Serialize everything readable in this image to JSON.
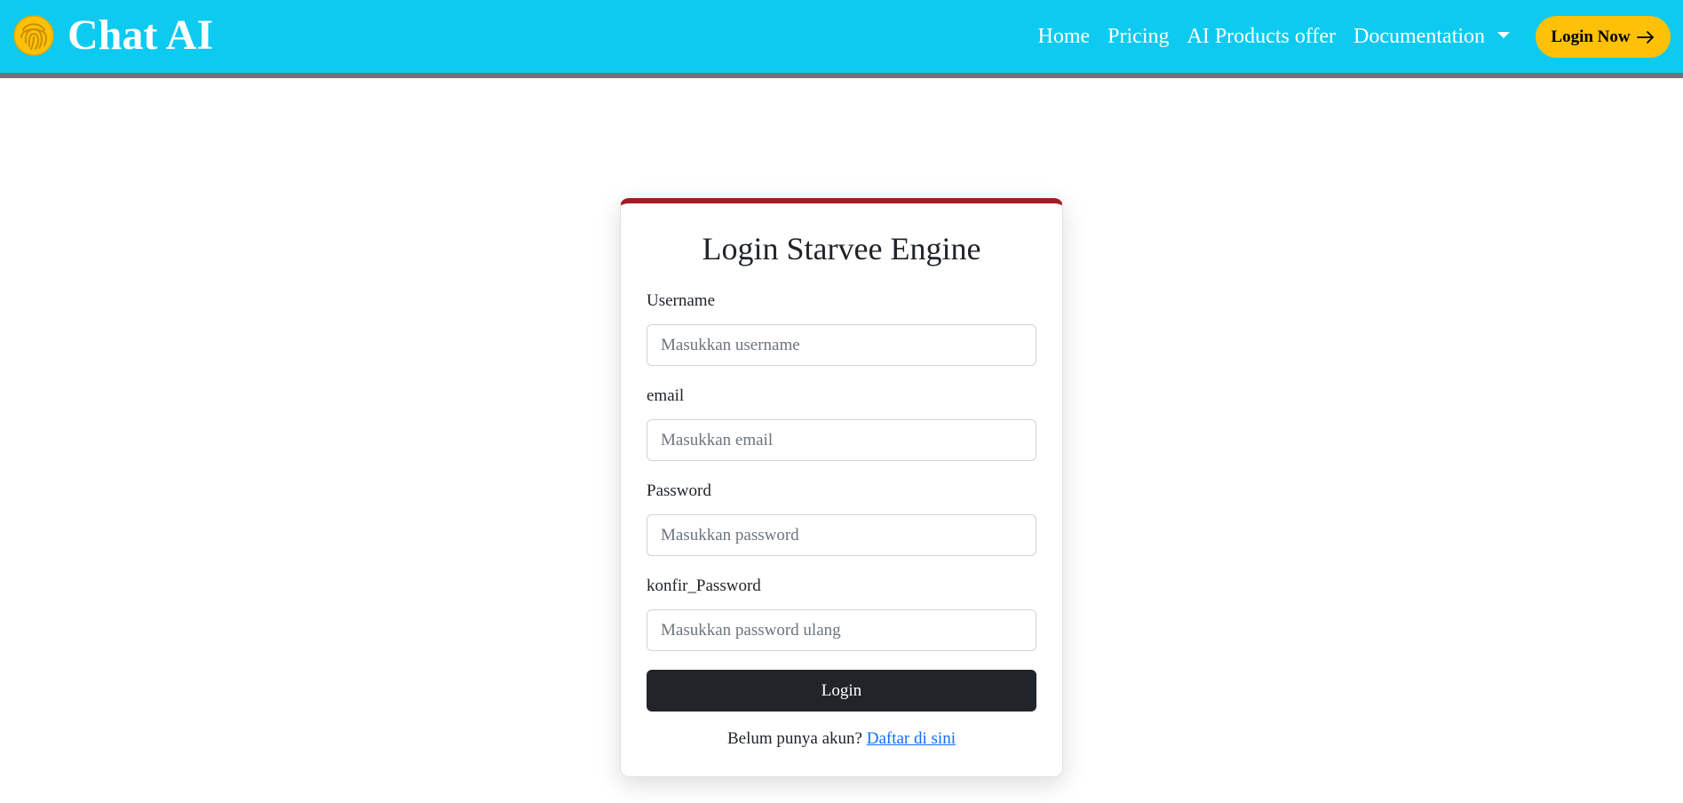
{
  "theme": {
    "navbar_bg": "#0dcaf0",
    "accent": "#ffc107",
    "card_top_border": "#a51c24",
    "link": "#0d6efd"
  },
  "navbar": {
    "brand_icon": "fingerprint-icon",
    "brand_title": "Chat AI",
    "links": [
      {
        "label": "Home"
      },
      {
        "label": "Pricing"
      },
      {
        "label": "AI Products offer"
      },
      {
        "label": "Documentation",
        "dropdown": true
      }
    ],
    "cta_label": "Login Now",
    "cta_icon": "arrow-right-icon"
  },
  "login_card": {
    "title": "Login Starvee Engine",
    "fields": [
      {
        "label": "Username",
        "placeholder": "Masukkan username",
        "value": ""
      },
      {
        "label": "email",
        "placeholder": "Masukkan email",
        "value": ""
      },
      {
        "label": "Password",
        "placeholder": "Masukkan password",
        "value": ""
      },
      {
        "label": "konfir_Password",
        "placeholder": "Masukkan password ulang",
        "value": ""
      }
    ],
    "submit_label": "Login",
    "signup_prompt": "Belum punya akun?",
    "signup_link": "Daftar di sini"
  }
}
